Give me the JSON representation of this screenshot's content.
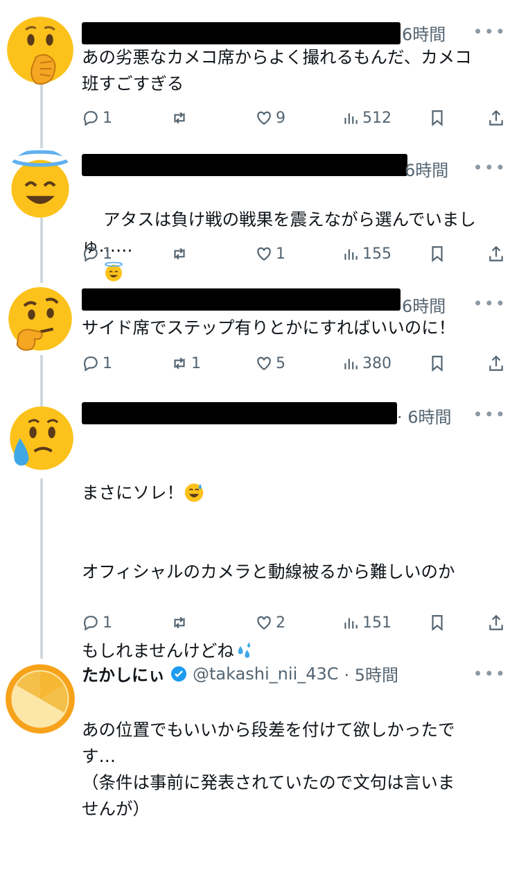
{
  "tweets": [
    {
      "time": "6時間",
      "body": "あの劣悪なカメコ席からよく撮れるもんだ、カメコ\n班すごすぎる",
      "replies": "1",
      "retweets": "",
      "likes": "9",
      "views": "512"
    },
    {
      "time": "6時間",
      "body": "アタスは負け戦の戦果を震えながら選んでいまし\nゅ……",
      "replies": "1",
      "retweets": "",
      "likes": "1",
      "views": "155"
    },
    {
      "time": "6時間",
      "body": "サイド席でステップ有りとかにすればいいのに！",
      "replies": "1",
      "retweets": "1",
      "likes": "5",
      "views": "380"
    },
    {
      "time": "· 6時間",
      "body_line1": "まさにソレ！",
      "body_line2": "オフィシャルのカメラと動線被るから難しいのか",
      "body_line3": "もしれませんけどね",
      "body_rest": "あの位置でもいいから段差を付けて欲しかったで\nす…\n（条件は事前に発表されていたので文句は言いま\nせんが）",
      "replies": "1",
      "retweets": "",
      "likes": "2",
      "views": "151"
    }
  ],
  "last_tweet": {
    "name": "たかしにぃ",
    "handle": "@takashi_nii_43C",
    "time": "· 5時間"
  },
  "more_label": "•••",
  "icons": [
    "reply-icon",
    "retweet-icon",
    "like-icon",
    "views-icon",
    "bookmark-icon",
    "share-icon"
  ],
  "colors": {
    "text": "#0f1419",
    "muted": "#536471",
    "thread": "#cfd9de",
    "verified": "#1d9bf0"
  }
}
